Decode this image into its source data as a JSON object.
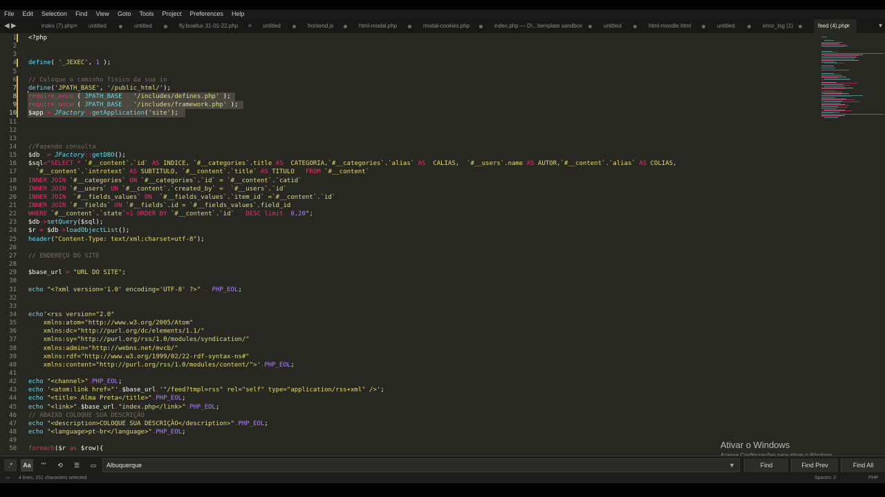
{
  "menu": [
    "File",
    "Edit",
    "Selection",
    "Find",
    "View",
    "Goto",
    "Tools",
    "Project",
    "Preferences",
    "Help"
  ],
  "tabs": [
    {
      "label": "index (7).php",
      "state": "close"
    },
    {
      "label": "untitled",
      "state": "dot"
    },
    {
      "label": "untitled",
      "state": "dot"
    },
    {
      "label": "fly.boatlux 31-01-22.php",
      "state": "close"
    },
    {
      "label": "untitled",
      "state": "dot"
    },
    {
      "label": "frontend.js",
      "state": "dot"
    },
    {
      "label": "html-modal.php",
      "state": "dot"
    },
    {
      "label": "modal-cookies.php",
      "state": "dot"
    },
    {
      "label": "index.php — D\\...\\template sandbox",
      "state": "dot"
    },
    {
      "label": "untitled",
      "state": "dot"
    },
    {
      "label": "html-moodle.html",
      "state": "dot"
    },
    {
      "label": "untitled",
      "state": "dot"
    },
    {
      "label": "error_log (1)",
      "state": "dot"
    },
    {
      "label": "feed (4).php",
      "state": "close",
      "active": true
    }
  ],
  "colors": {
    "background": "#272822",
    "keyword": "#f92672",
    "string": "#e6db74",
    "function": "#66d9ef",
    "comment": "#75715e",
    "number": "#ae81ff",
    "text": "#f8f8f2"
  },
  "code_lines": [
    {
      "n": 1,
      "segs": [
        [
          "<?php",
          "t"
        ]
      ]
    },
    {
      "n": 2,
      "segs": []
    },
    {
      "n": 3,
      "segs": []
    },
    {
      "n": 4,
      "segs": [
        [
          "define",
          "f"
        ],
        [
          "( ",
          "t"
        ],
        [
          "'_JEXEC'",
          "s"
        ],
        [
          ", ",
          "t"
        ],
        [
          "1",
          "n"
        ],
        [
          " );",
          "t"
        ]
      ]
    },
    {
      "n": 5,
      "segs": []
    },
    {
      "n": 6,
      "segs": [
        [
          "// Coloque o caminho fisico da sua in",
          "c"
        ]
      ]
    },
    {
      "n": 7,
      "segs": [
        [
          "define",
          "f"
        ],
        [
          "(",
          "t"
        ],
        [
          "'JPATH_BASE'",
          "s"
        ],
        [
          ", ",
          "t"
        ],
        [
          "'/public_html/'",
          "s"
        ],
        [
          ");",
          "t"
        ]
      ]
    },
    {
      "n": 8,
      "segs": [
        [
          "require_once",
          "k"
        ],
        [
          " ( ",
          "t"
        ],
        [
          "JPATH_BASE",
          "f"
        ],
        [
          " . ",
          "k"
        ],
        [
          "'/includes/defines.php'",
          "s"
        ],
        [
          " );",
          "t"
        ]
      ]
    },
    {
      "n": 9,
      "segs": [
        [
          "require_once",
          "k"
        ],
        [
          " ( ",
          "t"
        ],
        [
          "JPATH_BASE",
          "f"
        ],
        [
          " . ",
          "k"
        ],
        [
          "'/includes/framework.php'",
          "s"
        ],
        [
          " );",
          "t"
        ]
      ]
    },
    {
      "n": 10,
      "segs": [
        [
          "$app ",
          "t"
        ],
        [
          "= ",
          "k"
        ],
        [
          "JFactory",
          "fi"
        ],
        [
          "::",
          "k"
        ],
        [
          "getApplication",
          "f"
        ],
        [
          "(",
          "t"
        ],
        [
          "'site'",
          "s"
        ],
        [
          ");",
          "t"
        ]
      ]
    },
    {
      "n": 11,
      "segs": []
    },
    {
      "n": 12,
      "segs": []
    },
    {
      "n": 13,
      "segs": []
    },
    {
      "n": 14,
      "segs": [
        [
          "//Fazendo consulta",
          "c"
        ]
      ]
    },
    {
      "n": 15,
      "segs": [
        [
          "$db  ",
          "t"
        ],
        [
          "= ",
          "k"
        ],
        [
          "JFactory",
          "fi"
        ],
        [
          "::",
          "k"
        ],
        [
          "getDBO",
          "f"
        ],
        [
          "();",
          "t"
        ]
      ]
    },
    {
      "n": 16,
      "segs": [
        [
          "$sql",
          "t"
        ],
        [
          "=",
          "k"
        ],
        [
          "\"SELECT * ",
          "k"
        ],
        [
          "`#__content`.`id` ",
          "s"
        ],
        [
          "AS ",
          "k"
        ],
        [
          "INDICE, ",
          "s"
        ],
        [
          "`#__categories`.title ",
          "s"
        ],
        [
          "AS  ",
          "k"
        ],
        [
          "CATEGORIA,`#__categories`.`alias` ",
          "s"
        ],
        [
          "AS  ",
          "k"
        ],
        [
          "CALIAS,  `#__users`.name ",
          "s"
        ],
        [
          "AS ",
          "k"
        ],
        [
          "AUTOR,`#__content`.`alias` ",
          "s"
        ],
        [
          "AS ",
          "k"
        ],
        [
          "COLIAS,",
          "s"
        ]
      ]
    },
    {
      "n": 17,
      "segs": [
        [
          "  `#__content`.`introtext` ",
          "s"
        ],
        [
          "AS ",
          "k"
        ],
        [
          "SUBTITULO, `#__content`.`title` ",
          "s"
        ],
        [
          "AS ",
          "k"
        ],
        [
          "TITULO   ",
          "s"
        ],
        [
          "FROM ",
          "k"
        ],
        [
          "`#__content`",
          "s"
        ]
      ]
    },
    {
      "n": 18,
      "segs": [
        [
          "INNER JOIN ",
          "k"
        ],
        [
          "`#__categories` ",
          "s"
        ],
        [
          "ON ",
          "k"
        ],
        [
          "`#__categories`.`id` = `#__content`.`catid`",
          "s"
        ]
      ]
    },
    {
      "n": 19,
      "segs": [
        [
          "INNER JOIN ",
          "k"
        ],
        [
          "`#__users` ",
          "s"
        ],
        [
          "ON ",
          "k"
        ],
        [
          "`#__content`.`created_by` =  `#__users`.`id`",
          "s"
        ]
      ]
    },
    {
      "n": 20,
      "segs": [
        [
          "INNER JOIN  ",
          "k"
        ],
        [
          "`#__fields_values` ",
          "s"
        ],
        [
          "ON  ",
          "k"
        ],
        [
          "`#__fields_values`.`item_id` =`#__content`.`id`",
          "s"
        ]
      ]
    },
    {
      "n": 21,
      "segs": [
        [
          "INNER JOIN ",
          "k"
        ],
        [
          "`#__fields` ",
          "s"
        ],
        [
          "ON ",
          "k"
        ],
        [
          "`#__fields`.id = `#__fields_values`.field_id",
          "s"
        ]
      ]
    },
    {
      "n": 22,
      "segs": [
        [
          "WHERE ",
          "k"
        ],
        [
          "`#__content`.`state`",
          "s"
        ],
        [
          "=1 ",
          "k"
        ],
        [
          "ORDER BY ",
          "k"
        ],
        [
          "`#__content`.`id`   ",
          "s"
        ],
        [
          "DESC limit  ",
          "k"
        ],
        [
          "0,20",
          "n"
        ],
        [
          "\";",
          "s"
        ]
      ]
    },
    {
      "n": 23,
      "segs": [
        [
          "$db",
          "t"
        ],
        [
          "->",
          "k"
        ],
        [
          "setQuery",
          "f"
        ],
        [
          "($sql);",
          "t"
        ]
      ]
    },
    {
      "n": 24,
      "segs": [
        [
          "$r ",
          "t"
        ],
        [
          "= ",
          "k"
        ],
        [
          "$db",
          "t"
        ],
        [
          "->",
          "k"
        ],
        [
          "loadObjectList",
          "f"
        ],
        [
          "();",
          "t"
        ]
      ]
    },
    {
      "n": 25,
      "segs": [
        [
          "header",
          "f"
        ],
        [
          "(",
          "t"
        ],
        [
          "\"Content-Type: text/xml;charset=utf-8\"",
          "s"
        ],
        [
          ");",
          "t"
        ]
      ]
    },
    {
      "n": 26,
      "segs": []
    },
    {
      "n": 27,
      "segs": [
        [
          "// ENDEREÇO DO SITE",
          "c"
        ]
      ]
    },
    {
      "n": 28,
      "segs": []
    },
    {
      "n": 29,
      "segs": [
        [
          "$base_url ",
          "t"
        ],
        [
          "= ",
          "k"
        ],
        [
          "\"URL DO SITE\"",
          "s"
        ],
        [
          ";",
          "t"
        ]
      ]
    },
    {
      "n": 30,
      "segs": []
    },
    {
      "n": 31,
      "segs": [
        [
          "echo ",
          "f"
        ],
        [
          "\"<?xml version='1.0' encoding='UTF-8' ?>\"",
          "s"
        ],
        [
          " . ",
          "k"
        ],
        [
          "PHP_EOL",
          "n"
        ],
        [
          ";",
          "t"
        ]
      ]
    },
    {
      "n": 32,
      "segs": []
    },
    {
      "n": 33,
      "segs": []
    },
    {
      "n": 34,
      "segs": [
        [
          "echo",
          "f"
        ],
        [
          "'<rss version=\"2.0\"",
          "s"
        ]
      ]
    },
    {
      "n": 35,
      "segs": [
        [
          "    xmlns:atom=\"http://www.w3.org/2005/Atom\"",
          "s"
        ]
      ]
    },
    {
      "n": 36,
      "segs": [
        [
          "    xmlns:dc=\"http://purl.org/dc/elements/1.1/\"",
          "s"
        ]
      ]
    },
    {
      "n": 37,
      "segs": [
        [
          "    xmlns:sy=\"http://purl.org/rss/1.0/modules/syndication/\"",
          "s"
        ]
      ]
    },
    {
      "n": 38,
      "segs": [
        [
          "    xmlns:admin=\"http://webns.net/mvcb/\"",
          "s"
        ]
      ]
    },
    {
      "n": 39,
      "segs": [
        [
          "    xmlns:rdf=\"http://www.w3.org/1999/02/22-rdf-syntax-ns#\"",
          "s"
        ]
      ]
    },
    {
      "n": 40,
      "segs": [
        [
          "    xmlns:content=\"http://purl.org/rss/1.0/modules/content/\">'",
          "s"
        ],
        [
          ".",
          "k"
        ],
        [
          "PHP_EOL",
          "n"
        ],
        [
          ";",
          "t"
        ]
      ]
    },
    {
      "n": 41,
      "segs": []
    },
    {
      "n": 42,
      "segs": [
        [
          "echo ",
          "f"
        ],
        [
          "\"<channel>\"",
          "s"
        ],
        [
          ".",
          "k"
        ],
        [
          "PHP_EOL",
          "n"
        ],
        [
          ";",
          "t"
        ]
      ]
    },
    {
      "n": 43,
      "segs": [
        [
          "echo ",
          "f"
        ],
        [
          "'<atom:link href=\"'",
          "s"
        ],
        [
          ".",
          "k"
        ],
        [
          "$base_url",
          "t"
        ],
        [
          ".",
          "k"
        ],
        [
          "'\"/feed?tmpl=rss\" rel=\"self\" type=\"application/rss+xml\" />'",
          "s"
        ],
        [
          ";",
          "t"
        ]
      ]
    },
    {
      "n": 44,
      "segs": [
        [
          "echo ",
          "f"
        ],
        [
          "\"<title> Alma Preta</title>\"",
          "s"
        ],
        [
          ".",
          "k"
        ],
        [
          "PHP_EOL",
          "n"
        ],
        [
          ";",
          "t"
        ]
      ]
    },
    {
      "n": 45,
      "segs": [
        [
          "echo ",
          "f"
        ],
        [
          "\"<link>\"",
          "s"
        ],
        [
          ".",
          "k"
        ],
        [
          "$base_url",
          "t"
        ],
        [
          ".",
          "k"
        ],
        [
          "\"index.php</link>\"",
          "s"
        ],
        [
          ".",
          "k"
        ],
        [
          "PHP_EOL",
          "n"
        ],
        [
          ";",
          "t"
        ]
      ]
    },
    {
      "n": 46,
      "segs": [
        [
          "// ABAIXO COLOQUE SUA DESCRIÇÃO",
          "c"
        ]
      ]
    },
    {
      "n": 47,
      "segs": [
        [
          "echo ",
          "f"
        ],
        [
          "\"<description>COLOQUE SUA DESCRIÇÃO</description>\"",
          "s"
        ],
        [
          ".",
          "k"
        ],
        [
          "PHP_EOL",
          "n"
        ],
        [
          ";",
          "t"
        ]
      ]
    },
    {
      "n": 48,
      "segs": [
        [
          "echo ",
          "f"
        ],
        [
          "\"<language>pt-br</language>\"",
          "s"
        ],
        [
          ".",
          "k"
        ],
        [
          "PHP_EOL",
          "n"
        ],
        [
          ";",
          "t"
        ]
      ]
    },
    {
      "n": 49,
      "segs": []
    },
    {
      "n": 50,
      "segs": [
        [
          "foreach",
          "k"
        ],
        [
          "($r ",
          "t"
        ],
        [
          "as ",
          "k"
        ],
        [
          "$row){",
          "t"
        ]
      ]
    }
  ],
  "find": {
    "regex_label": ".*",
    "case_label": "Aa",
    "word_label": "\"\"",
    "value": "Albuquerque",
    "find": "Find",
    "find_prev": "Find Prev",
    "find_all": "Find All"
  },
  "watermark": {
    "title": "Ativar o Windows",
    "subtitle": "Acesse Configurações para ativar o Windows."
  },
  "status": {
    "left": "4 lines, 151 characters selected",
    "spaces": "Spaces: 2",
    "syntax": "PHP"
  }
}
